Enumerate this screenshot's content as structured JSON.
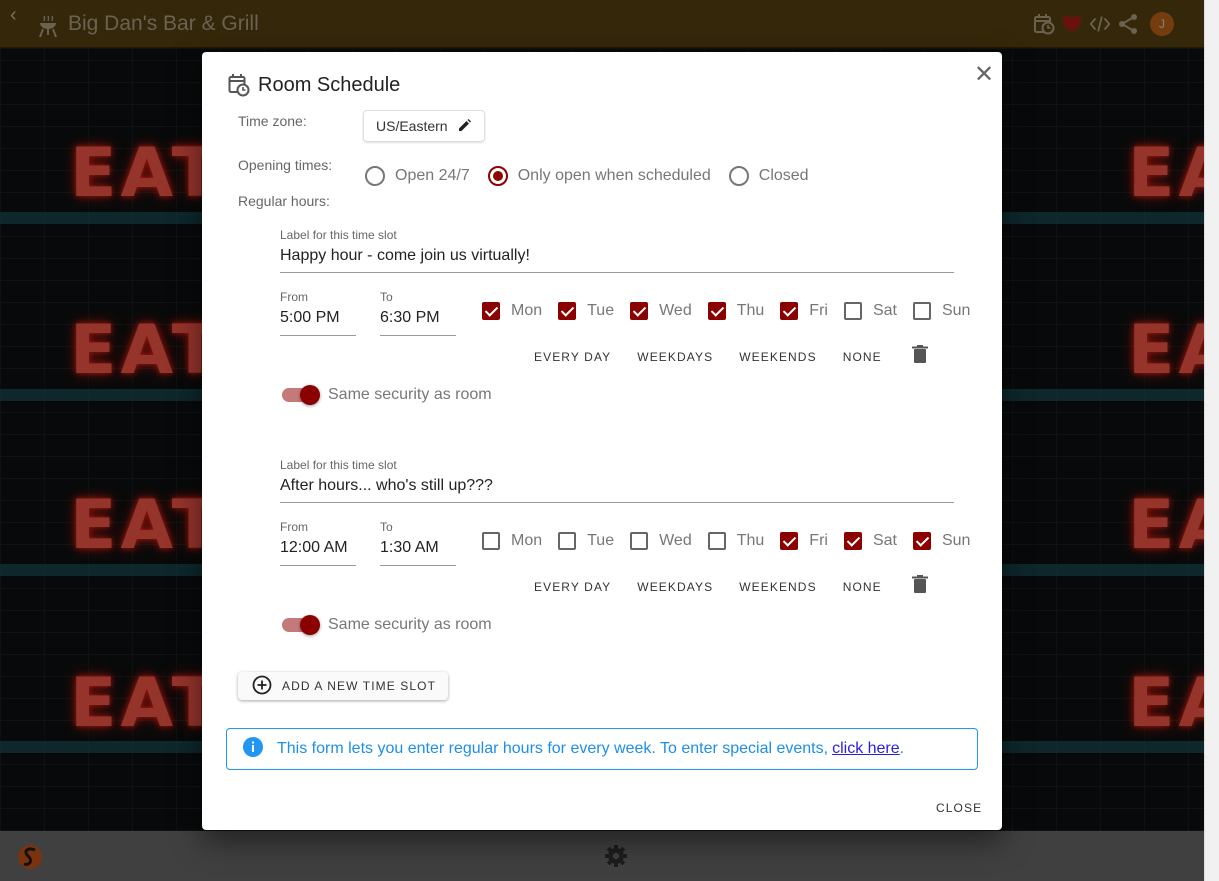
{
  "header": {
    "title": "Big Dan's Bar & Grill",
    "avatar_initial": "J",
    "icons": [
      "back-icon",
      "grill-icon",
      "schedule-icon",
      "heart-icon",
      "code-icon",
      "share-icon"
    ]
  },
  "background": {
    "sign_text": "EAT"
  },
  "dialog": {
    "title": "Room Schedule",
    "timezone_label": "Time zone:",
    "timezone_value": "US/Eastern",
    "opening_label": "Opening times:",
    "regular_hours_label": "Regular hours:",
    "opening_options": [
      {
        "label": "Open 24/7",
        "selected": false
      },
      {
        "label": "Only open when scheduled",
        "selected": true
      },
      {
        "label": "Closed",
        "selected": false
      }
    ],
    "slot_label_caption": "Label for this time slot",
    "from_caption": "From",
    "to_caption": "To",
    "quick_buttons": [
      "EVERY DAY",
      "WEEKDAYS",
      "WEEKENDS",
      "NONE"
    ],
    "security_label": "Same security as room",
    "slots": [
      {
        "label": "Happy hour - come join us virtually!",
        "from": "5:00 PM",
        "to": "6:30 PM",
        "days": [
          {
            "name": "Mon",
            "checked": true
          },
          {
            "name": "Tue",
            "checked": true
          },
          {
            "name": "Wed",
            "checked": true
          },
          {
            "name": "Thu",
            "checked": true
          },
          {
            "name": "Fri",
            "checked": true
          },
          {
            "name": "Sat",
            "checked": false
          },
          {
            "name": "Sun",
            "checked": false
          }
        ],
        "same_security": true
      },
      {
        "label": "After hours... who's still up???",
        "from": "12:00 AM",
        "to": "1:30 AM",
        "days": [
          {
            "name": "Mon",
            "checked": false
          },
          {
            "name": "Tue",
            "checked": false
          },
          {
            "name": "Wed",
            "checked": false
          },
          {
            "name": "Thu",
            "checked": false
          },
          {
            "name": "Fri",
            "checked": true
          },
          {
            "name": "Sat",
            "checked": true
          },
          {
            "name": "Sun",
            "checked": true
          }
        ],
        "same_security": true
      }
    ],
    "add_slot_label": "ADD A NEW TIME SLOT",
    "info_text": "This form lets you enter regular hours for every week. To enter special events,",
    "info_link": "click here",
    "info_suffix": ".",
    "close_label": "CLOSE"
  },
  "colors": {
    "header_bg": "#5c4410",
    "accent": "#8b0000",
    "info": "#2196f3",
    "link": "#2a1ee0"
  }
}
